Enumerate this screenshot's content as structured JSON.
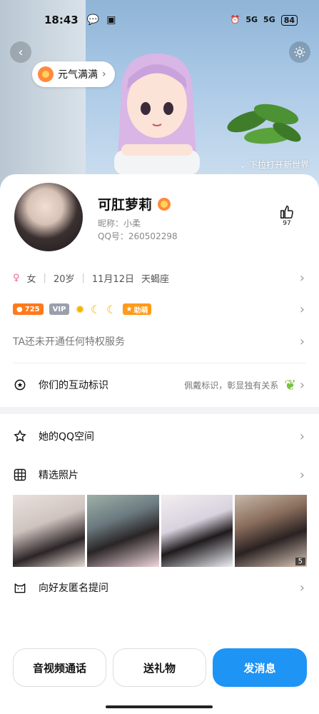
{
  "status_bar": {
    "time": "18:43",
    "battery": "84",
    "signal1": "5G",
    "signal2": "5G"
  },
  "header": {
    "mood_label": "元气满满",
    "pull_hint": "下拉打开新世界"
  },
  "profile": {
    "name": "可肛萝莉",
    "nickname": "昵称：小柔",
    "qq_number": "QQ号：260502298",
    "likes": "97"
  },
  "info": {
    "gender_icon": "♀",
    "gender": "女",
    "age": "20岁",
    "birthday": "11月12日",
    "zodiac": "天蝎座"
  },
  "badges": {
    "level": "725",
    "vip": "VIP",
    "tag": "助萌"
  },
  "privilege_text": "TA还未开通任何特权服务",
  "interaction": {
    "label": "你们的互动标识",
    "hint": "佩戴标识，彰显独有关系"
  },
  "menu": {
    "qzone": "她的QQ空间",
    "photos": "精选照片",
    "photo_count": "5",
    "ask": "向好友匿名提问"
  },
  "actions": {
    "call": "音视频通话",
    "gift": "送礼物",
    "message": "发消息"
  },
  "colors": {
    "primary": "#1e94f5",
    "level_badge": "#ff7a1a",
    "vip_badge": "#9aa0ab"
  }
}
